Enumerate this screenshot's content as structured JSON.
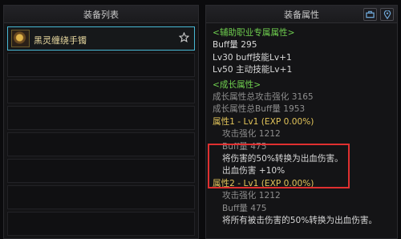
{
  "left_panel": {
    "title": "装备列表",
    "items": [
      {
        "name": "黑灵缠绕手镯"
      },
      {
        "name": ""
      },
      {
        "name": ""
      },
      {
        "name": ""
      },
      {
        "name": ""
      },
      {
        "name": ""
      },
      {
        "name": ""
      },
      {
        "name": ""
      }
    ]
  },
  "right_panel": {
    "title": "装备属性",
    "icons": [
      "hat-icon",
      "location-pin-icon"
    ]
  },
  "attrs": {
    "section1": "<辅助职业专属属性>",
    "buff": "Buff量  295",
    "lv30": "Lv30 buff技能Lv+1",
    "lv50": "Lv50 主动技能Lv+1",
    "section2": "<成长属性>",
    "grow1": "成长属性总攻击强化 3165",
    "grow2": "成长属性总Buff量 1953",
    "prop1_title": "属性1 - Lv1 (EXP 0.00%)",
    "prop1_atk": "攻击强化  1212",
    "prop1_buff": "Buff量  475",
    "prop1_desc": "将伤害的50%转换为出血伤害。",
    "prop1_bleed": "出血伤害 +10%",
    "prop2_title": "属性2 - Lv1 (EXP 0.00%)",
    "prop2_atk": "攻击强化  1212",
    "prop2_buff": "Buff量  475",
    "prop2_desc": "将所有被击伤害的50%转换为出血伤害。"
  },
  "colors": {
    "selected_border": "#48b8d4",
    "green": "#6fcf4f",
    "gold": "#e2c45a",
    "highlight": "#e03030"
  }
}
